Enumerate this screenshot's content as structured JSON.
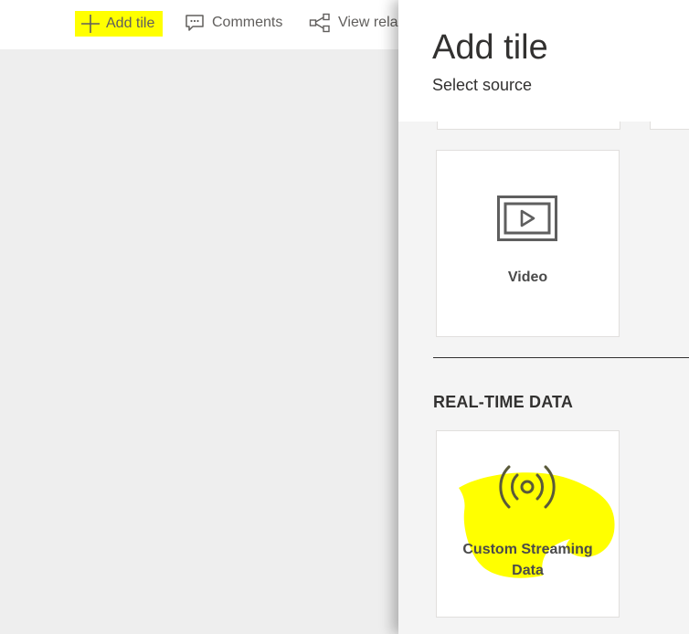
{
  "toolbar": {
    "add_tile_label": "Add tile",
    "comments_label": "Comments",
    "view_related_label": "View rela",
    "highlight_color": "#ffff00",
    "icons": [
      "plus-icon",
      "comment-icon",
      "share-nodes-icon"
    ]
  },
  "pane": {
    "title": "Add tile",
    "subtitle": "Select source",
    "tiles": [
      {
        "label": "Video",
        "icon": "video-icon"
      }
    ],
    "section_heading": "REAL-TIME DATA",
    "realtime_tiles": [
      {
        "label": "Custom Streaming Data",
        "icon": "broadcast-icon",
        "highlighted": true
      }
    ]
  }
}
